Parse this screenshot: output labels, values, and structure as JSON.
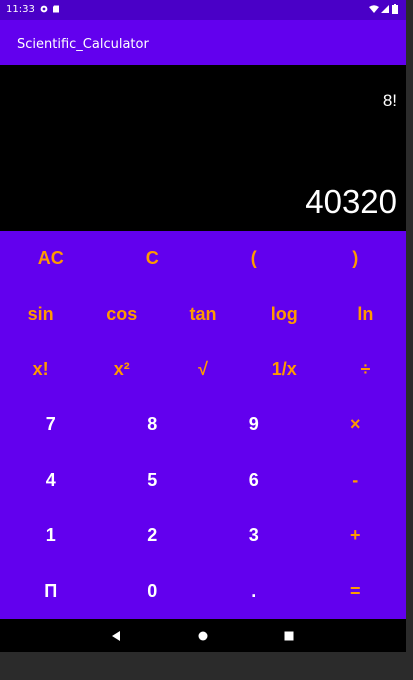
{
  "status_bar": {
    "time": "11:33"
  },
  "app_bar": {
    "title": "Scientific_Calculator"
  },
  "display": {
    "expression": "8!",
    "result": "40320"
  },
  "colors": {
    "app_bar": "#6200ee",
    "status_bar": "#4a00c7",
    "keypad": "#6200ee",
    "operator_text": "#ff9a00",
    "digit_text": "#ffffff"
  },
  "keypad": {
    "row1": [
      "AC",
      "C",
      "(",
      ")"
    ],
    "row2": [
      "sin",
      "cos",
      "tan",
      "log",
      "ln"
    ],
    "row3": [
      "x!",
      "x²",
      "√",
      "1/x",
      "÷"
    ],
    "row4": [
      "7",
      "8",
      "9",
      "×"
    ],
    "row5": [
      "4",
      "5",
      "6",
      "-"
    ],
    "row6": [
      "1",
      "2",
      "3",
      "+"
    ],
    "row7": [
      "Π",
      "0",
      ".",
      "="
    ]
  },
  "nav_bar": {
    "icons": [
      "back-icon",
      "home-icon",
      "recents-icon"
    ]
  }
}
